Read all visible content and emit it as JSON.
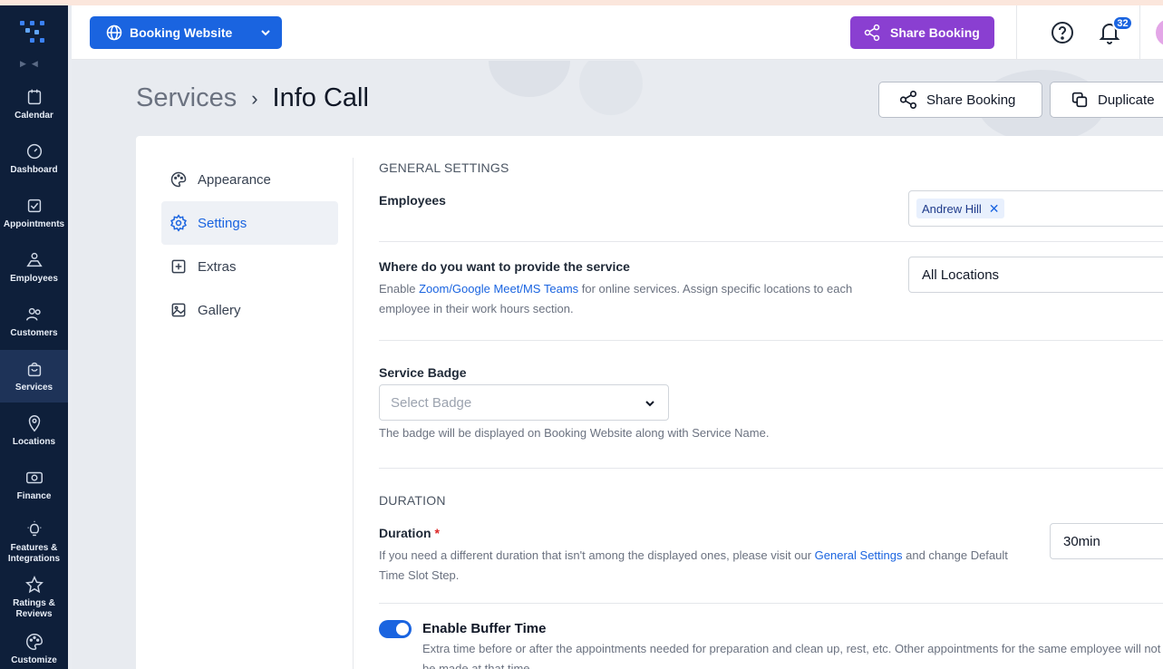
{
  "header": {
    "site_button": "Booking Website",
    "share_button": "Share Booking",
    "notification_count": "32"
  },
  "sidebar": {
    "items": [
      {
        "label": "Calendar",
        "icon": "calendar-icon"
      },
      {
        "label": "Dashboard",
        "icon": "dashboard-icon"
      },
      {
        "label": "Appointments",
        "icon": "appointments-icon"
      },
      {
        "label": "Employees",
        "icon": "employees-icon"
      },
      {
        "label": "Customers",
        "icon": "customers-icon"
      },
      {
        "label": "Services",
        "icon": "services-icon",
        "active": true
      },
      {
        "label": "Locations",
        "icon": "location-pin-icon"
      },
      {
        "label": "Finance",
        "icon": "finance-icon"
      },
      {
        "label": "Features & Integrations",
        "icon": "lightbulb-icon"
      },
      {
        "label": "Ratings & Reviews",
        "icon": "star-icon"
      },
      {
        "label": "Customize",
        "icon": "palette-icon"
      }
    ]
  },
  "page": {
    "breadcrumb_parent": "Services",
    "breadcrumb_current": "Info Call",
    "share_button": "Share Booking",
    "duplicate_button": "Duplicate"
  },
  "sub_nav": {
    "items": [
      {
        "label": "Appearance",
        "icon": "palette-icon"
      },
      {
        "label": "Settings",
        "icon": "gear-icon",
        "active": true
      },
      {
        "label": "Extras",
        "icon": "plus-square-icon"
      },
      {
        "label": "Gallery",
        "icon": "image-icon"
      }
    ]
  },
  "general": {
    "heading": "GENERAL SETTINGS",
    "employees_label": "Employees",
    "employee_tag": "Andrew Hill",
    "where_label": "Where do you want to provide the service",
    "where_help_pre": "Enable ",
    "where_help_link": "Zoom/Google Meet/MS Teams",
    "where_help_post": " for online services. Assign specific locations to each employee in their work hours section.",
    "location_value": "All Locations",
    "badge_label": "Service Badge",
    "badge_placeholder": "Select Badge",
    "badge_help": "The badge will be displayed on Booking Website along with Service Name."
  },
  "duration": {
    "heading": "DURATION",
    "label": "Duration",
    "required_mark": "*",
    "help_pre": "If you need a different duration that isn't among the displayed ones, please visit our ",
    "help_link": "General Settings",
    "help_post": " and change Default Time Slot Step.",
    "value": "30min",
    "buffer_label": "Enable Buffer Time",
    "buffer_enabled": true,
    "buffer_help": "Extra time before or after the appointments needed for preparation and clean up, rest, etc. Other appointments for the same employee will not be made at that time."
  },
  "colors": {
    "primary": "#1a64e0",
    "share_purple": "#8a3fd1",
    "sidebar_bg": "#0e1f3a"
  }
}
